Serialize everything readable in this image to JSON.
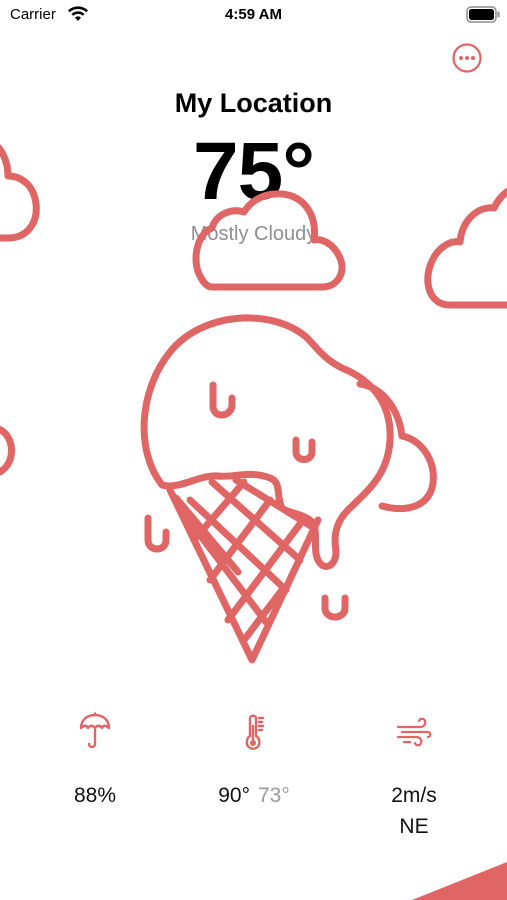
{
  "status_bar": {
    "carrier": "Carrier",
    "time": "4:59 AM"
  },
  "header": {
    "more_icon": "ellipsis-circle-icon"
  },
  "weather": {
    "location": "My Location",
    "temperature": "75°",
    "condition": "Mostly Cloudy"
  },
  "stats": {
    "precipitation": {
      "icon": "umbrella-icon",
      "value": "88%"
    },
    "temperature_range": {
      "icon": "thermometer-icon",
      "high": "90°",
      "low": "73°"
    },
    "wind": {
      "icon": "wind-icon",
      "speed": "2m/s",
      "direction": "NE"
    }
  },
  "colors": {
    "accent": "#e06666",
    "text": "#000000",
    "secondary_text": "#8e8e93"
  }
}
